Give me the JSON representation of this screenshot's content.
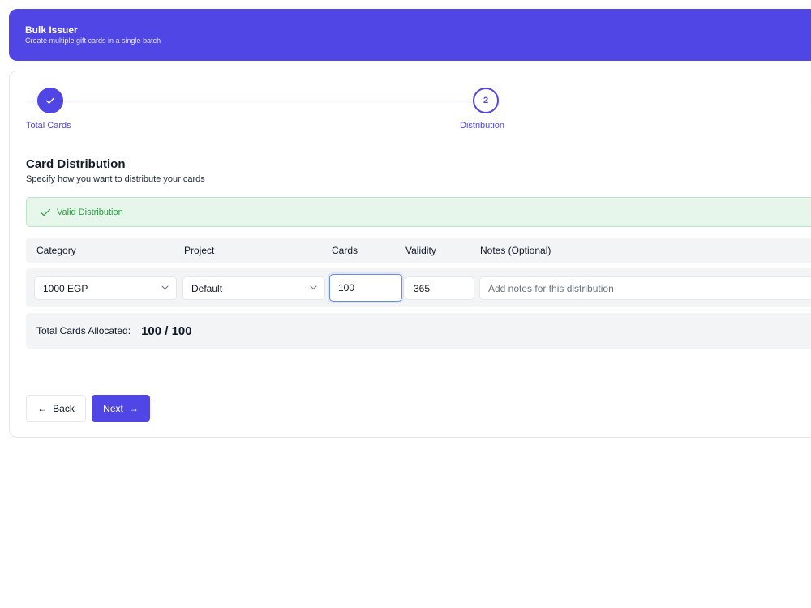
{
  "header": {
    "title": "Bulk Issuer",
    "subtitle": "Create multiple gift cards in a single batch"
  },
  "stepper": {
    "steps": [
      {
        "label": "Total Cards",
        "state": "completed",
        "icon": "check-icon"
      },
      {
        "label": "Distribution",
        "number": "2",
        "state": "active"
      }
    ]
  },
  "section": {
    "title": "Card Distribution",
    "subtitle": "Specify how you want to distribute your cards"
  },
  "alert": {
    "text": "Valid Distribution",
    "icon": "check-icon",
    "color": "#2f9e44"
  },
  "table": {
    "columns": [
      "Category",
      "Project",
      "Cards",
      "Validity",
      "Notes (Optional)"
    ],
    "rows": [
      {
        "category": "1000 EGP",
        "project": "Default",
        "cards": "100",
        "validity": "365",
        "notes_placeholder": "Add notes for this distribution"
      }
    ]
  },
  "totals": {
    "label": "Total Cards Allocated:",
    "value": "100 / 100"
  },
  "buttons": {
    "back_label": "Back",
    "back_icon": "arrow-left-icon",
    "next_label": "Next",
    "next_icon": "arrow-right-icon"
  },
  "colors": {
    "accent": "#4f46e5",
    "success": "#2f9e44",
    "success_bg": "#e6f6ea"
  }
}
